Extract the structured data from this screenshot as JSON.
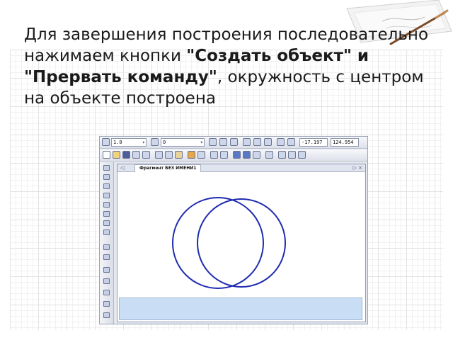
{
  "slide": {
    "text_part1": "Для завершения построения последовательно нажимаем кнопки ",
    "text_bold": "\"Создать объект\" и \"Прервать команду\"",
    "text_part2": ", окружность с центром на объекте построена"
  },
  "app": {
    "toolbar": {
      "scale_value": "1.0",
      "layer_value": "0",
      "coord_x": "-17.197",
      "coord_y": "124.954"
    },
    "document": {
      "tab_title": "Фрагмент БЕЗ ИМЕНИ1",
      "nav_arrow": "◁",
      "tab_controls": "▷ ×"
    },
    "drawing": {
      "stroke_color": "#1f2bb0",
      "circle_count": 2
    },
    "icons": {
      "toolbar_row1": [
        "grid-icon",
        "cursor-icon",
        "ortho-icon",
        "snap-icon",
        "magnet-icon",
        "lines-icon",
        "axes-icon",
        "corner-icon",
        "arrow-snap-icon",
        "local-cs-icon"
      ],
      "toolbar_row2": [
        "new-document-icon",
        "open-folder-icon",
        "save-icon",
        "print-icon",
        "preview-icon",
        "cut-icon",
        "copy-icon",
        "paste-icon",
        "brush-icon",
        "properties-icon",
        "undo-icon",
        "redo-icon",
        "layers-icon",
        "fill-icon",
        "variables-icon",
        "help-cursor-icon",
        "zoom-icon",
        "zoom-window-icon",
        "zoom-fit-icon"
      ],
      "left_bar": [
        "geometry-icon",
        "dimensions-icon",
        "symbols-icon",
        "edit-icon",
        "parametric-icon",
        "measure-icon",
        "select-icon",
        "spec-icon",
        "point-icon",
        "line-icon",
        "auxiliary-line-icon",
        "circle-icon",
        "arc-icon",
        "ellipse-icon",
        "polyline-icon"
      ]
    }
  }
}
